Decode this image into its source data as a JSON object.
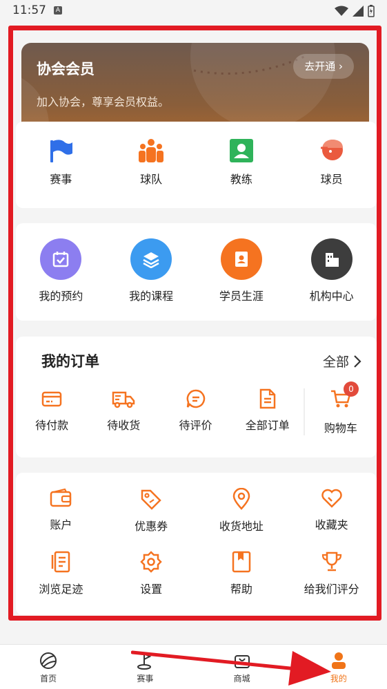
{
  "status_bar": {
    "time": "11:57",
    "badge": "A"
  },
  "membership": {
    "title": "协会会员",
    "subtitle": "加入协会，尊享会员权益。",
    "open_button": "去开通"
  },
  "categories": [
    {
      "label": "赛事",
      "icon": "flag-icon"
    },
    {
      "label": "球队",
      "icon": "team-icon"
    },
    {
      "label": "教练",
      "icon": "coach-icon"
    },
    {
      "label": "球员",
      "icon": "player-icon"
    }
  ],
  "services": [
    {
      "label": "我的预约",
      "icon": "calendar-icon",
      "color": "#8c7ef0"
    },
    {
      "label": "我的课程",
      "icon": "layers-icon",
      "color": "#3c9bf0"
    },
    {
      "label": "学员生涯",
      "icon": "profile-card-icon",
      "color": "#f57320"
    },
    {
      "label": "机构中心",
      "icon": "building-icon",
      "color": "#3d3d3d"
    }
  ],
  "orders": {
    "title": "我的订单",
    "all_label": "全部",
    "items": [
      {
        "label": "待付款",
        "icon": "payment-card-icon"
      },
      {
        "label": "待收货",
        "icon": "delivery-truck-icon"
      },
      {
        "label": "待评价",
        "icon": "comment-icon"
      },
      {
        "label": "全部订单",
        "icon": "document-icon"
      },
      {
        "label": "购物车",
        "icon": "cart-icon",
        "badge": "0"
      }
    ]
  },
  "tools": [
    {
      "label": "账户",
      "icon": "wallet-icon"
    },
    {
      "label": "优惠券",
      "icon": "coupon-tag-icon"
    },
    {
      "label": "收货地址",
      "icon": "location-pin-icon"
    },
    {
      "label": "收藏夹",
      "icon": "heart-icon"
    },
    {
      "label": "浏览足迹",
      "icon": "history-book-icon"
    },
    {
      "label": "设置",
      "icon": "settings-gear-icon"
    },
    {
      "label": "帮助",
      "icon": "help-book-icon"
    },
    {
      "label": "给我们评分",
      "icon": "trophy-icon"
    }
  ],
  "tabbar": [
    {
      "label": "首页",
      "icon": "home-ball-icon"
    },
    {
      "label": "赛事",
      "icon": "golf-flag-icon"
    },
    {
      "label": "商城",
      "icon": "shop-bag-icon"
    },
    {
      "label": "我的",
      "icon": "user-icon",
      "active": true
    }
  ],
  "colors": {
    "accent": "#f07418",
    "highlight_border": "#e21b23",
    "annotation_arrow": "#e21b23"
  }
}
